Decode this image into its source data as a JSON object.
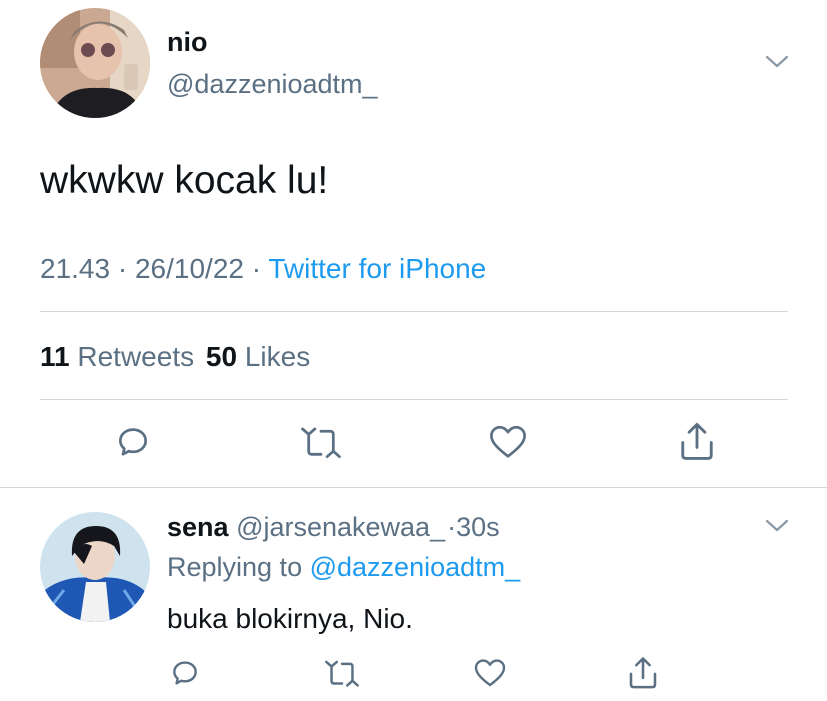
{
  "main_tweet": {
    "author_name": "nio",
    "author_handle": "@dazzenioadtm_",
    "text": "wkwkw kocak lu!",
    "time": "21.43",
    "date": "26/10/22",
    "source": "Twitter for iPhone",
    "separator": "·",
    "retweets_count": "11",
    "retweets_label": "Retweets",
    "likes_count": "50",
    "likes_label": "Likes"
  },
  "reply": {
    "author_name": "sena",
    "author_handle": "@jarsenakewaa_",
    "separator": "·",
    "time_ago": "30s",
    "replying_to_label": "Replying to",
    "replying_to_handle": "@dazzenioadtm_",
    "text": "buka blokirnya, Nio."
  },
  "icons": {
    "reply": "reply-icon",
    "retweet": "retweet-icon",
    "like": "heart-icon",
    "share": "share-icon",
    "more": "chevron-down-icon"
  },
  "colors": {
    "link": "#1d9bf0",
    "muted": "#5b7083",
    "text": "#0f1419",
    "divider": "#cfd9de"
  }
}
